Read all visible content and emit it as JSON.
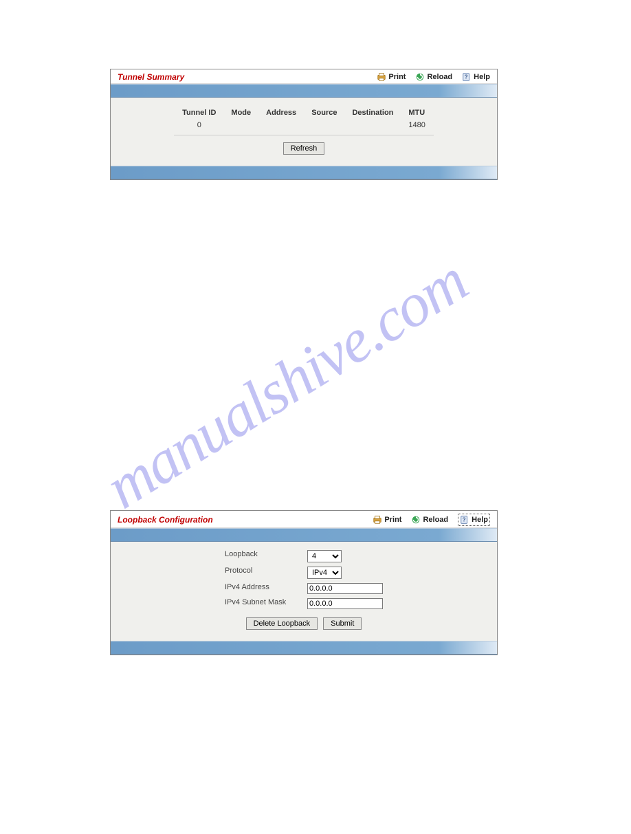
{
  "watermark": "manualshive.com",
  "toolbar": {
    "print_label": "Print",
    "reload_label": "Reload",
    "help_label": "Help"
  },
  "panel1": {
    "title": "Tunnel Summary",
    "columns": {
      "c1": "Tunnel ID",
      "c2": "Mode",
      "c3": "Address",
      "c4": "Source",
      "c5": "Destination",
      "c6": "MTU"
    },
    "row": {
      "tunnel_id": "0",
      "mode": "",
      "address": "",
      "source": "",
      "destination": "",
      "mtu": "1480"
    },
    "refresh_label": "Refresh"
  },
  "panel2": {
    "title": "Loopback Configuration",
    "fields": {
      "loopback_label": "Loopback",
      "loopback_value": "4",
      "protocol_label": "Protocol",
      "protocol_value": "IPv4",
      "ipv4addr_label": "IPv4 Address",
      "ipv4addr_value": "0.0.0.0",
      "ipv4mask_label": "IPv4 Subnet Mask",
      "ipv4mask_value": "0.0.0.0"
    },
    "delete_label": "Delete Loopback",
    "submit_label": "Submit"
  }
}
